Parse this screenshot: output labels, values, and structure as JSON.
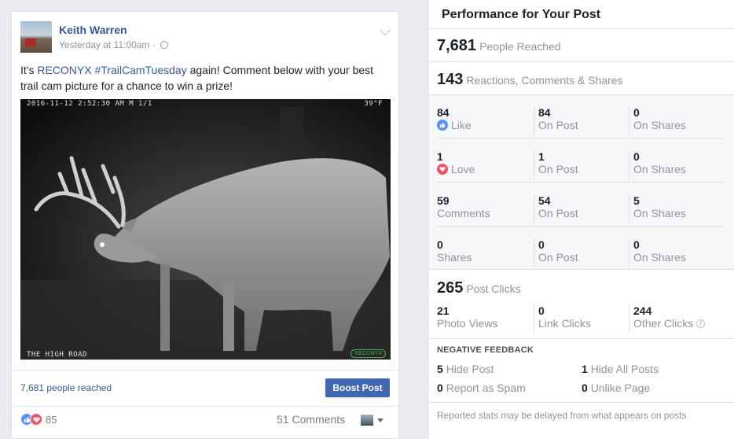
{
  "post": {
    "author": "Keith Warren",
    "time": "Yesterday at 11:00am",
    "text_prefix": "It's ",
    "text_link1": "RECONYX",
    "text_link2": "#TrailCamTuesday",
    "text_suffix": " again! Comment below with your best trail cam picture for a chance to win a prize!",
    "photo": {
      "stamp_date": "2016-11-12",
      "stamp_time": "2:52:30 AM",
      "stamp_frame": "M 1/1",
      "stamp_temp": "39°F",
      "stamp_bottom": "THE HIGH ROAD",
      "brand": "RECONYX"
    },
    "reached": "7,681 people reached",
    "boost_label": "Boost Post",
    "reaction_count": "85",
    "comments": "51 Comments"
  },
  "panel": {
    "title": "Performance for Your Post",
    "reached_num": "7,681",
    "reached_label": "People Reached",
    "engagement_num": "143",
    "engagement_label": "Reactions, Comments & Shares",
    "rows": [
      {
        "n1": "84",
        "l1": "Like",
        "n2": "84",
        "l2": "On Post",
        "n3": "0",
        "l3": "On Shares"
      },
      {
        "n1": "1",
        "l1": "Love",
        "n2": "1",
        "l2": "On Post",
        "n3": "0",
        "l3": "On Shares"
      },
      {
        "n1": "59",
        "l1": "Comments",
        "n2": "54",
        "l2": "On Post",
        "n3": "5",
        "l3": "On Shares"
      },
      {
        "n1": "0",
        "l1": "Shares",
        "n2": "0",
        "l2": "On Post",
        "n3": "0",
        "l3": "On Shares"
      }
    ],
    "clicks_num": "265",
    "clicks_label": "Post Clicks",
    "clicks": {
      "n1": "21",
      "l1": "Photo Views",
      "n2": "0",
      "l2": "Link Clicks",
      "n3": "244",
      "l3": "Other Clicks"
    },
    "negative_title": "NEGATIVE FEEDBACK",
    "negative": {
      "hide_post_n": "5",
      "hide_post": "Hide Post",
      "hide_all_n": "1",
      "hide_all": "Hide All Posts",
      "spam_n": "0",
      "spam": "Report as Spam",
      "unlike_n": "0",
      "unlike": "Unlike Page"
    },
    "footer": "Reported stats may be delayed from what appears on posts"
  },
  "icons": {
    "like": "thumbs-up-icon",
    "love": "heart-icon",
    "privacy": "globe-icon",
    "info": "info-icon"
  },
  "colors": {
    "link": "#365899",
    "boost": "#4267b2",
    "like": "#5890ff",
    "love": "#f25268"
  }
}
